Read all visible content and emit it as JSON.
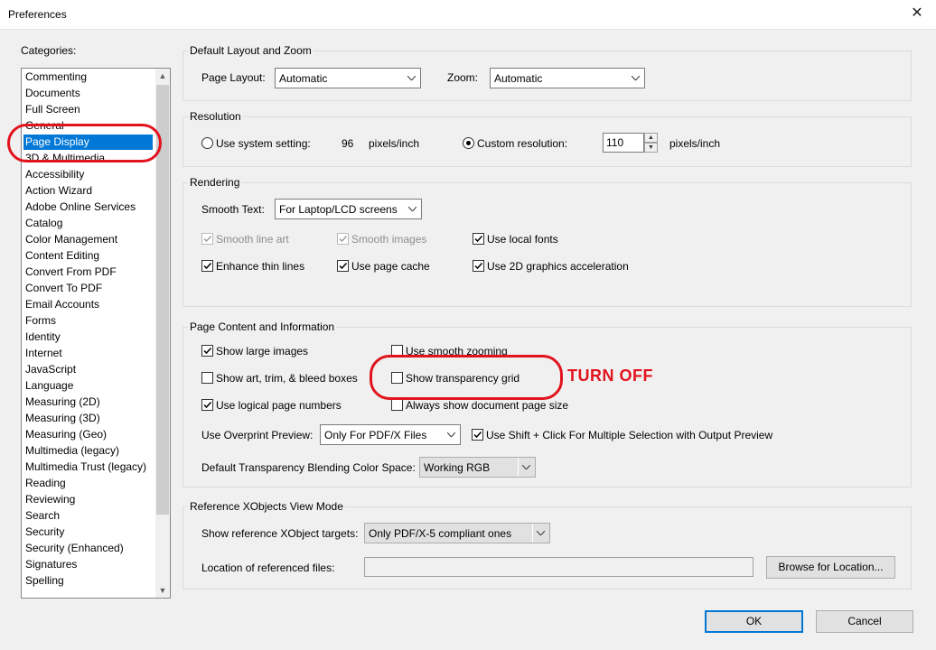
{
  "window": {
    "title": "Preferences",
    "close_glyph": "✕"
  },
  "categories": {
    "label": "Categories:",
    "items": [
      "Commenting",
      "Documents",
      "Full Screen",
      "General",
      "Page Display",
      "3D & Multimedia",
      "Accessibility",
      "Action Wizard",
      "Adobe Online Services",
      "Catalog",
      "Color Management",
      "Content Editing",
      "Convert From PDF",
      "Convert To PDF",
      "Email Accounts",
      "Forms",
      "Identity",
      "Internet",
      "JavaScript",
      "Language",
      "Measuring (2D)",
      "Measuring (3D)",
      "Measuring (Geo)",
      "Multimedia (legacy)",
      "Multimedia Trust (legacy)",
      "Reading",
      "Reviewing",
      "Search",
      "Security",
      "Security (Enhanced)",
      "Signatures",
      "Spelling"
    ],
    "selected": "Page Display"
  },
  "layout_zoom": {
    "title": "Default Layout and Zoom",
    "page_layout_label": "Page Layout:",
    "page_layout_value": "Automatic",
    "zoom_label": "Zoom:",
    "zoom_value": "Automatic"
  },
  "resolution": {
    "title": "Resolution",
    "system_label": "Use system setting:",
    "system_value": "96",
    "system_unit": "pixels/inch",
    "custom_label": "Custom resolution:",
    "custom_value": "110",
    "custom_unit": "pixels/inch",
    "selected": "custom"
  },
  "rendering": {
    "title": "Rendering",
    "smooth_text_label": "Smooth Text:",
    "smooth_text_value": "For Laptop/LCD screens",
    "smooth_line_art": "Smooth line art",
    "smooth_images": "Smooth images",
    "use_local_fonts": "Use local fonts",
    "enhance_thin_lines": "Enhance thin lines",
    "use_page_cache": "Use page cache",
    "use_2d_accel": "Use 2D graphics acceleration"
  },
  "page_content": {
    "title": "Page Content and Information",
    "show_large_images": "Show large images",
    "use_smooth_zooming": "Use smooth zooming",
    "show_art_trim_bleed": "Show art, trim, & bleed boxes",
    "show_transparency_grid": "Show transparency grid",
    "use_logical_page_numbers": "Use logical page numbers",
    "always_show_doc_page_size": "Always show document page size",
    "overprint_label": "Use Overprint Preview:",
    "overprint_value": "Only For PDF/X Files",
    "shift_click_label": "Use Shift + Click For Multiple Selection with Output Preview",
    "blending_label": "Default Transparency Blending Color Space:",
    "blending_value": "Working RGB"
  },
  "xobjects": {
    "title": "Reference XObjects View Mode",
    "targets_label": "Show reference XObject targets:",
    "targets_value": "Only PDF/X-5 compliant ones",
    "location_label": "Location of referenced files:",
    "location_value": "",
    "browse_button": "Browse for Location..."
  },
  "buttons": {
    "ok": "OK",
    "cancel": "Cancel"
  },
  "annotation": {
    "text": "TURN OFF",
    "color": "#e1141e"
  },
  "colors": {
    "selection": "#0078d7",
    "accent_red": "#e1141e"
  }
}
